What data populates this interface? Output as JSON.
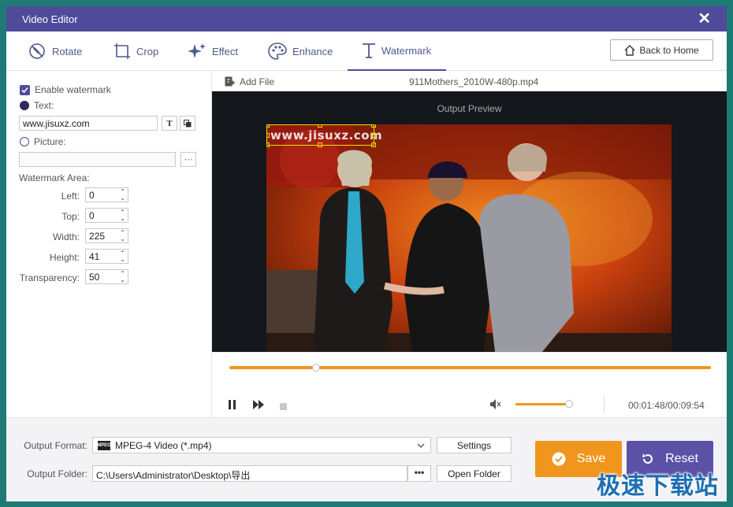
{
  "window": {
    "title": "Video Editor"
  },
  "toolbar": {
    "tabs": [
      {
        "label": "Rotate",
        "icon": "rotate-icon"
      },
      {
        "label": "Crop",
        "icon": "crop-icon"
      },
      {
        "label": "Effect",
        "icon": "sparkle-icon"
      },
      {
        "label": "Enhance",
        "icon": "palette-icon"
      },
      {
        "label": "Watermark",
        "icon": "text-t-icon",
        "active": true
      }
    ],
    "back_label": "Back to Home"
  },
  "watermark": {
    "enable_label": "Enable watermark",
    "enabled": true,
    "text_label": "Text:",
    "text_value": "www.jisuxz.com",
    "picture_label": "Picture:",
    "picture_value": "",
    "area_label": "Watermark Area:",
    "fields": [
      {
        "label": "Left:",
        "value": "0"
      },
      {
        "label": "Top:",
        "value": "0"
      },
      {
        "label": "Width:",
        "value": "225"
      },
      {
        "label": "Height:",
        "value": "41"
      },
      {
        "label": "Transparency:",
        "value": "50"
      }
    ]
  },
  "file": {
    "add_label": "Add File",
    "name": "911Mothers_2010W-480p.mp4"
  },
  "preview": {
    "label": "Output Preview",
    "overlay_text": "www.jisuxz.com"
  },
  "playback": {
    "progress": 0.18,
    "volume": 1.0,
    "time": "00:01:48/00:09:54"
  },
  "output": {
    "format_label": "Output Format:",
    "format_value": "MPEG-4 Video (*.mp4)",
    "format_icon_text": "MPEG",
    "settings_label": "Settings",
    "folder_label": "Output Folder:",
    "folder_value": "C:\\Users\\Administrator\\Desktop\\导出",
    "folder_button": "•••",
    "open_folder_label": "Open Folder"
  },
  "actions": {
    "save_label": "Save",
    "reset_label": "Reset"
  },
  "brand": {
    "watermark_text": "极速下载站"
  },
  "colors": {
    "title_bar": "#4f4a9a",
    "accent_orange": "#f0961e",
    "reset_purple": "#5b52a8",
    "teal_bg": "#1d7a74"
  }
}
